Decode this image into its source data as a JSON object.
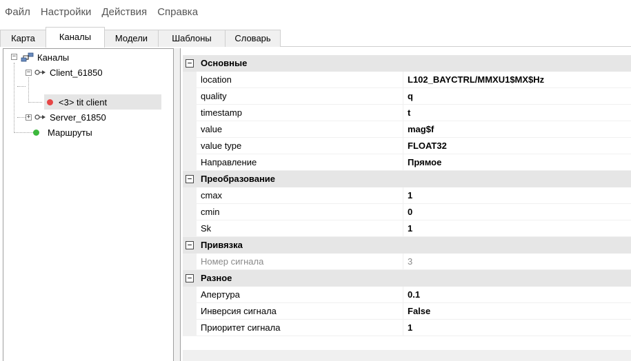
{
  "menu": [
    "Файл",
    "Настройки",
    "Действия",
    "Справка"
  ],
  "tabs": [
    "Карта",
    "Каналы",
    "Модели",
    "Шаблоны",
    "Словарь"
  ],
  "active_tab": "Каналы",
  "tree": {
    "root": "Каналы",
    "client": "Client_61850",
    "client_child": "<3> tit client",
    "server": "Server_61850",
    "routes": "Маршруты"
  },
  "colors": {
    "status_red": "#e64646",
    "status_green": "#3cb83c",
    "selection": "#e5e5e5"
  },
  "properties": [
    {
      "category": "Основные",
      "items": [
        {
          "name": "location",
          "value": "L102_BAYCTRL/MMXU1$MX$Hz"
        },
        {
          "name": "quality",
          "value": "q"
        },
        {
          "name": "timestamp",
          "value": "t"
        },
        {
          "name": "value",
          "value": "mag$f"
        },
        {
          "name": "value type",
          "value": "FLOAT32"
        },
        {
          "name": "Направление",
          "value": "Прямое"
        }
      ]
    },
    {
      "category": "Преобразование",
      "items": [
        {
          "name": "cmax",
          "value": "1"
        },
        {
          "name": "cmin",
          "value": "0"
        },
        {
          "name": "Sk",
          "value": "1"
        }
      ]
    },
    {
      "category": "Привязка",
      "items": [
        {
          "name": "Номер сигнала",
          "value": "3",
          "disabled": true
        }
      ]
    },
    {
      "category": "Разное",
      "items": [
        {
          "name": "Апертура",
          "value": "0.1"
        },
        {
          "name": "Инверсия сигнала",
          "value": "False"
        },
        {
          "name": "Приоритет сигнала",
          "value": "1"
        }
      ]
    }
  ]
}
